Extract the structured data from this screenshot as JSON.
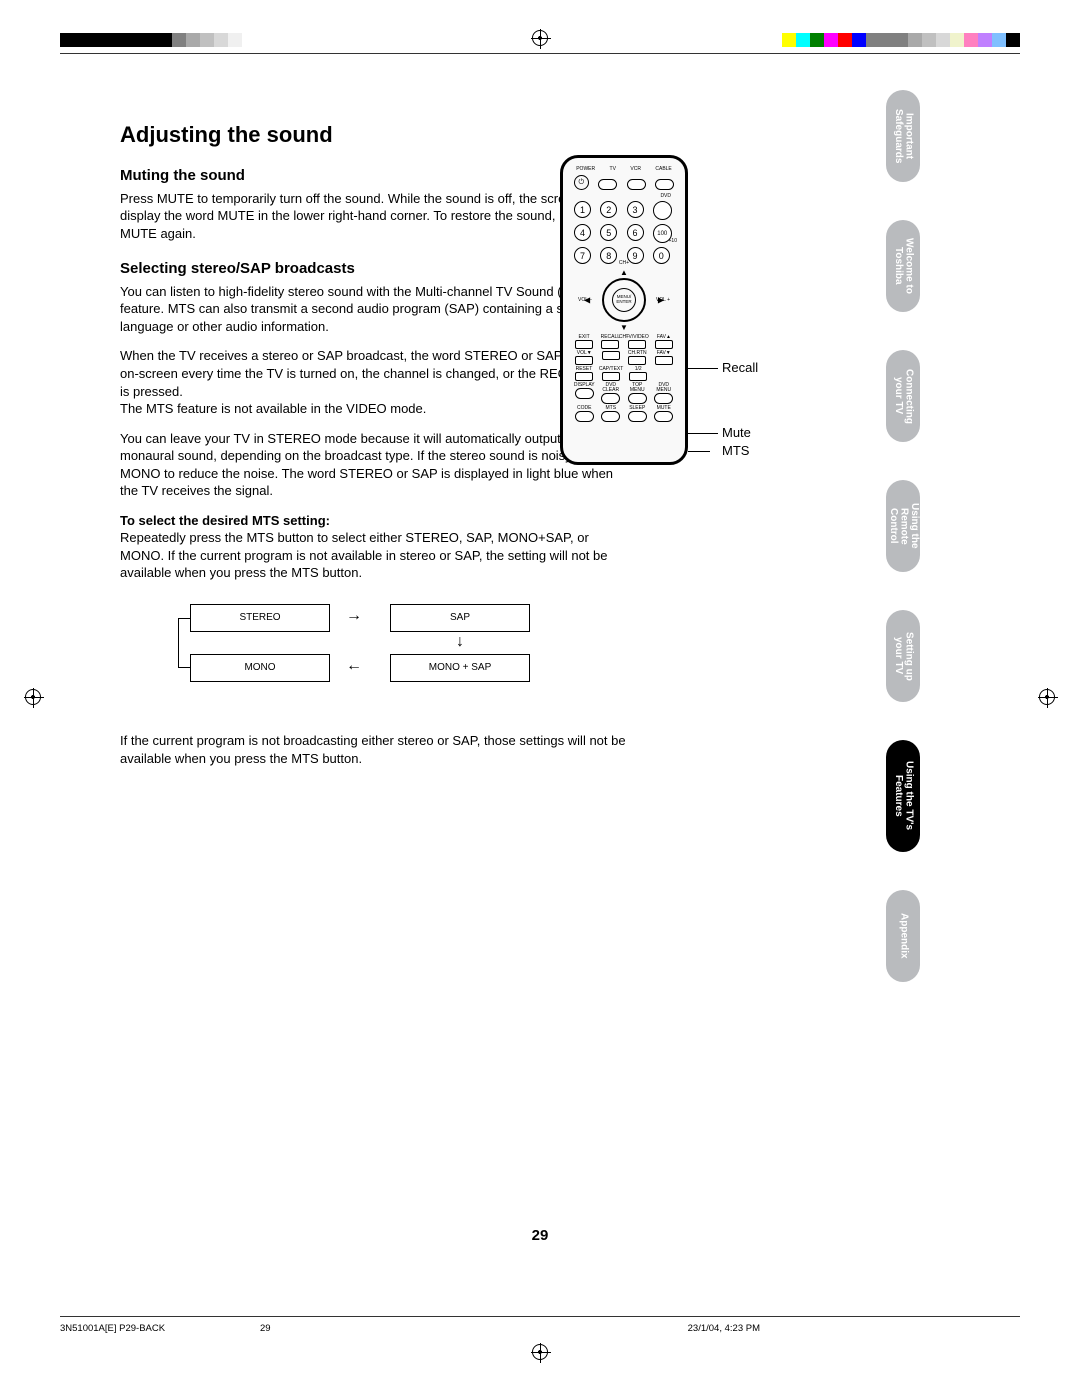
{
  "topbar": {
    "left_squares": [
      "#000",
      "#000",
      "#000",
      "#000",
      "#000",
      "#000",
      "#000",
      "#000",
      "#808080",
      "#a9a9a9",
      "#c0c0c0",
      "#d8d8d8",
      "#f0f0f0",
      "#ffffff"
    ],
    "right_squares": [
      "#ffff00",
      "#00ffff",
      "#008000",
      "#ff00ff",
      "#ff0000",
      "#0000ff",
      "#808080",
      "#808080",
      "#808080",
      "#a9a9a9",
      "#c0c0c0",
      "#d8d8d8",
      "#f0f3cc",
      "#ff80c0",
      "#c080ff",
      "#80c0ff",
      "#000000"
    ]
  },
  "headings": {
    "h1": "Adjusting the sound",
    "h2_mute": "Muting the sound",
    "h2_sap": "Selecting stereo/SAP broadcasts",
    "h3_mts": "To select the desired MTS setting:"
  },
  "body": {
    "mute_p": "Press MUTE to temporarily turn off the sound. While the sound is off, the screen will display the word MUTE in the lower right-hand corner. To restore the sound, press MUTE again.",
    "sap_p1": "You can listen to high-fidelity stereo sound with the Multi-channel TV Sound (MTS) feature. MTS can also transmit a second audio program (SAP) containing a second language or other audio information.",
    "sap_p2": "When the TV receives a stereo or SAP broadcast, the word STEREO or SAP appears on-screen every time the TV is turned on, the channel is changed, or the RECALL button is pressed.",
    "sap_p2b": "The MTS feature is not available in the VIDEO mode.",
    "sap_p3": "You can leave your TV in STEREO mode because it will automatically output stereo or monaural sound, depending on the broadcast type. If the stereo sound is noisy, select MONO to reduce the noise. The word STEREO or SAP is displayed in light blue when the TV receives the signal.",
    "mts_p1": "Repeatedly press the MTS button to select either STEREO, SAP, MONO+SAP, or MONO. If the current program is not available in stereo or SAP, the setting will not be available when you press the MTS button.",
    "mts_p2": "If the current program is not broadcasting either stereo or SAP, those settings will not be available when you press the MTS button."
  },
  "flow": {
    "stereo": "STEREO",
    "sap": "SAP",
    "mono": "MONO",
    "mono_sap": "MONO + SAP"
  },
  "remote": {
    "top_labels": [
      "POWER",
      "TV",
      "VCR",
      "CABLE"
    ],
    "dvd": "DVD",
    "plus10": "+10",
    "nums": [
      "1",
      "2",
      "3",
      "",
      "4",
      "5",
      "6",
      "100",
      "7",
      "8",
      "9",
      "0"
    ],
    "nav": {
      "center_top": "MENU/",
      "center_bot": "ENTER",
      "ch_plus": "CH+",
      "ch_minus": "CH−",
      "vol_l": "VOL\n−",
      "vol_r": "VOL\n+"
    },
    "row1": [
      "EXIT",
      "RECALL",
      "TV/VIDEO",
      "FAV▲"
    ],
    "row2": [
      "VOL▼",
      "",
      "CH.RTN",
      "FAV▼"
    ],
    "row3": [
      "RESET",
      "CAP/TEXT",
      "1/2",
      ""
    ],
    "row4": [
      "DISPLAY",
      "DVD CLEAR",
      "TOP MENU",
      "DVD MENU"
    ],
    "row5": [
      "CODE",
      "MTS",
      "SLEEP",
      "MUTE"
    ],
    "callouts": {
      "recall": "Recall",
      "mute": "Mute",
      "mts": "MTS"
    }
  },
  "tabs": [
    {
      "l1": "Important",
      "l2": "Safeguards",
      "active": false
    },
    {
      "l1": "Welcome to",
      "l2": "Toshiba",
      "active": false
    },
    {
      "l1": "Connecting",
      "l2": "your TV",
      "active": false
    },
    {
      "l1": "Using the",
      "l2": "Remote Control",
      "active": false
    },
    {
      "l1": "Setting up",
      "l2": "your TV",
      "active": false
    },
    {
      "l1": "Using the TV's",
      "l2": "Features",
      "active": true
    },
    {
      "l1": "Appendix",
      "l2": "",
      "active": false
    }
  ],
  "page_number": "29",
  "footer": {
    "left": "3N51001A[E] P29-BACK",
    "mid": "29",
    "right": "23/1/04, 4:23 PM"
  }
}
